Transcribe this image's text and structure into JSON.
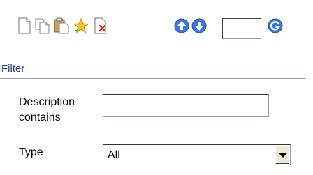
{
  "toolbar": {
    "icons": [
      "new-document-icon",
      "copy-icon",
      "paste-icon",
      "favorite-star-icon",
      "delete-document-icon",
      "move-up-icon",
      "move-down-icon",
      "go-icon"
    ],
    "page_input_value": ""
  },
  "filter": {
    "title": "Filter",
    "description_label_line1": "Description",
    "description_label_line2": "contains",
    "description_value": "",
    "type_label": "Type",
    "type_selected": "All"
  },
  "colors": {
    "accent": "#1f3e8a",
    "header_rule": "#8a9fc9",
    "nav_icon_blue": "#3b78d8"
  }
}
